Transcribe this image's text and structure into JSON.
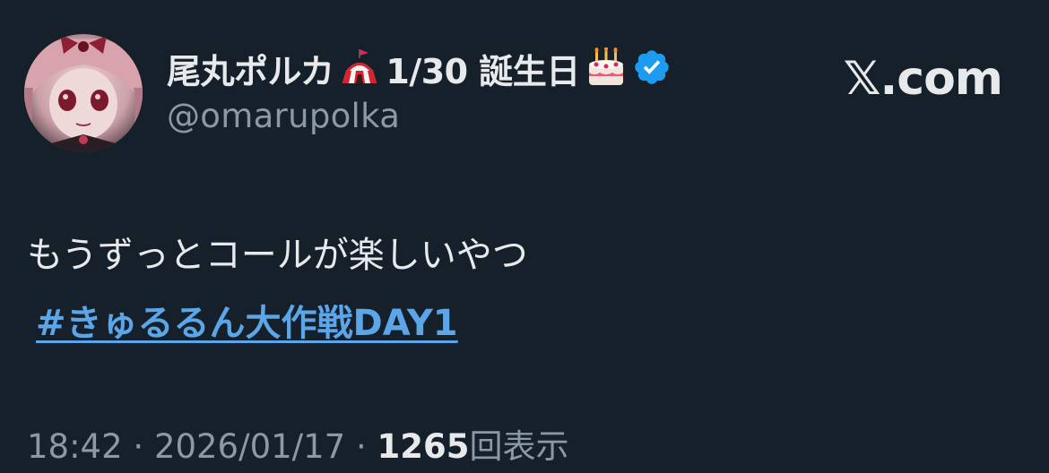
{
  "author": {
    "display_name": "尾丸ポルカ",
    "birthday_text": "1/30 誕生日",
    "handle": "@omarupolka",
    "name_emoji_1": "circus-tent-icon",
    "name_emoji_2": "birthday-cake-icon",
    "verified_icon": "verified-badge-icon"
  },
  "site_label": "𝕏.com",
  "tweet": {
    "text": "もうずっとコールが楽しいやつ",
    "hashtag": "#きゅるるん大作戦DAY1"
  },
  "meta": {
    "time": "18:42",
    "separator": "·",
    "date": "2026/01/17",
    "views_count": "1265",
    "views_label": "回表示"
  },
  "colors": {
    "background": "#16202b",
    "text_primary": "#e7e9ea",
    "text_secondary": "#8b98a5",
    "link": "#5ba6e8",
    "verified": "#1d9bf0"
  }
}
